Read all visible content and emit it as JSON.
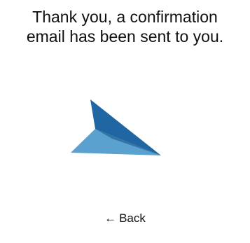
{
  "confirmation": {
    "line1": "Thank you, a confirmation",
    "line2": "email has been sent to you."
  },
  "illustration": {
    "icon": "paper-plane-icon",
    "colors": {
      "top_wing": "#1f66a3",
      "bottom_wing": "#5aa1cf",
      "fold": "#174f80"
    }
  },
  "back": {
    "arrow": "←",
    "label": "Back"
  }
}
